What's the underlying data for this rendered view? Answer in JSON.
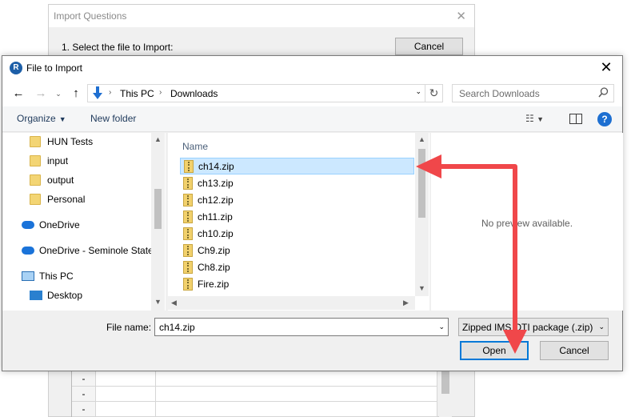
{
  "background_window": {
    "title": "Import Questions",
    "step_label": "1.  Select the file to Import:",
    "cancel_label": "Cancel",
    "table_rows": [
      "-",
      "-",
      "-"
    ]
  },
  "dialog": {
    "title": "File to Import",
    "app_icon_letter": "R",
    "breadcrumb": [
      "This PC",
      "Downloads"
    ],
    "search_placeholder": "Search Downloads",
    "toolbar": {
      "organize_label": "Organize",
      "new_folder_label": "New folder"
    },
    "nav_items": [
      {
        "label": "HUN Tests",
        "icon": "folder-icon"
      },
      {
        "label": "input",
        "icon": "folder-icon"
      },
      {
        "label": "output",
        "icon": "folder-icon"
      },
      {
        "label": "Personal",
        "icon": "folder-icon"
      },
      {
        "label": "OneDrive",
        "icon": "onedrive-icon"
      },
      {
        "label": "OneDrive - Seminole State",
        "icon": "onedrive-icon"
      },
      {
        "label": "This PC",
        "icon": "pc-icon"
      },
      {
        "label": "Desktop",
        "icon": "desktop-icon"
      }
    ],
    "column_header": "Name",
    "files": [
      {
        "name": "ch14.zip",
        "selected": true
      },
      {
        "name": "ch13.zip",
        "selected": false
      },
      {
        "name": "ch12.zip",
        "selected": false
      },
      {
        "name": "ch11.zip",
        "selected": false
      },
      {
        "name": "ch10.zip",
        "selected": false
      },
      {
        "name": "Ch9.zip",
        "selected": false
      },
      {
        "name": "Ch8.zip",
        "selected": false
      },
      {
        "name": "Fire.zip",
        "selected": false
      }
    ],
    "preview_text": "No preview available.",
    "file_name_label": "File name:",
    "file_name_value": "ch14.zip",
    "file_type_value": "Zipped IMS QTI package (.zip) (",
    "open_label": "Open",
    "cancel_label": "Cancel"
  },
  "colors": {
    "selection": "#cce8ff",
    "annotation": "#f0474a",
    "accent": "#0078d7"
  }
}
